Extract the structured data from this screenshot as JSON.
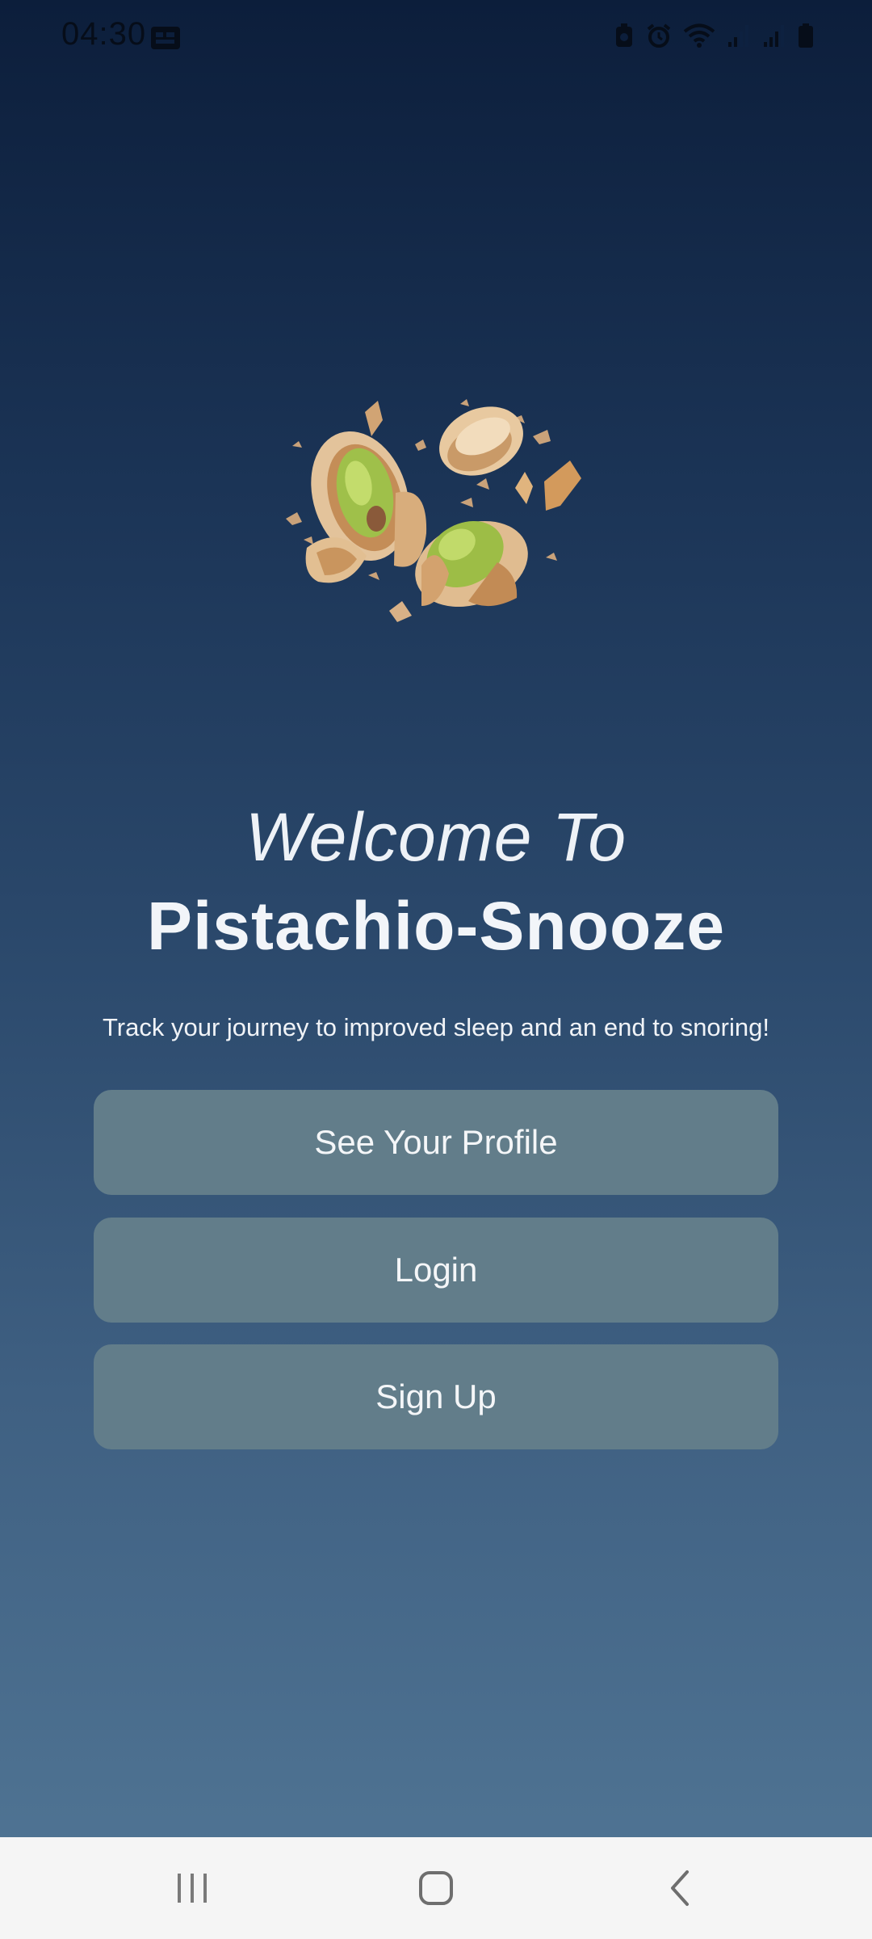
{
  "status_bar": {
    "time": "04:30",
    "icons": [
      "notification-icon",
      "battery-saver-icon",
      "alarm-icon",
      "wifi-icon",
      "signal-icon",
      "signal-icon-2",
      "battery-icon"
    ]
  },
  "hero": {
    "image": "pistachio-nuts-image"
  },
  "welcome": {
    "line1": "Welcome To",
    "app_name": "Pistachio-Snooze",
    "tagline": "Track your journey to improved sleep and an end to snoring!"
  },
  "buttons": {
    "profile": "See Your Profile",
    "login": "Login",
    "signup": "Sign Up"
  },
  "nav_bar": {
    "icons": [
      "recents-icon",
      "home-icon",
      "back-icon"
    ]
  },
  "colors": {
    "background_top": "#0c1e3b",
    "background_bottom": "#527796",
    "button": "#627d8a",
    "text": "#f4f6f8",
    "nav_bar": "#f5f5f5"
  }
}
